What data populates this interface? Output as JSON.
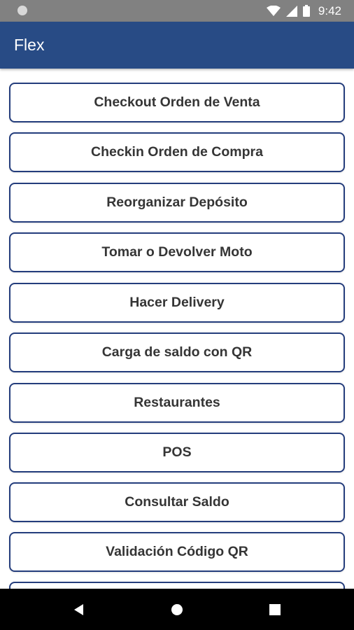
{
  "status_bar": {
    "time": "9:42",
    "icons": [
      "notification-dot-icon",
      "wifi-icon",
      "cell-signal-icon",
      "battery-icon"
    ]
  },
  "app_bar": {
    "title": "Flex"
  },
  "menu": {
    "items": [
      {
        "label": "Checkout Orden de Venta"
      },
      {
        "label": "Checkin Orden de Compra"
      },
      {
        "label": "Reorganizar Depósito"
      },
      {
        "label": "Tomar o Devolver Moto"
      },
      {
        "label": "Hacer Delivery"
      },
      {
        "label": "Carga de saldo con QR"
      },
      {
        "label": "Restaurantes"
      },
      {
        "label": "POS"
      },
      {
        "label": "Consultar Saldo"
      },
      {
        "label": "Validación Código QR"
      },
      {
        "label": ""
      }
    ]
  },
  "nav_bar": {
    "icons": [
      "back-icon",
      "home-icon",
      "recents-icon"
    ]
  },
  "colors": {
    "app_bar": "#284b85",
    "status_bar": "#818181",
    "button_border": "#243d7c",
    "button_text": "#353535"
  }
}
